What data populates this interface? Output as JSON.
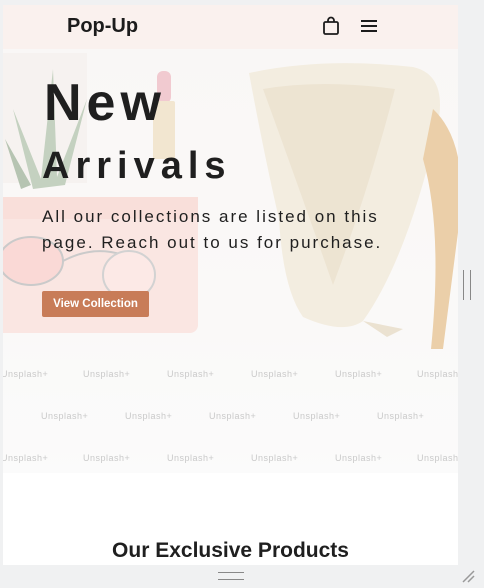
{
  "header": {
    "brand": "Pop-Up",
    "cart_icon": "shopping-bag-icon",
    "menu_icon": "hamburger-menu-icon"
  },
  "hero": {
    "title_line1": "New",
    "title_line2": "Arrivals",
    "description": "All our collections are listed on this page. Reach out to us for purchase.",
    "cta_label": "View Collection",
    "cta_color": "#c87c58",
    "watermark": "Unsplash+"
  },
  "section": {
    "title": "Our Exclusive Products"
  },
  "colors": {
    "header_bg": "#faf1ee",
    "text": "#1f1f1f"
  }
}
